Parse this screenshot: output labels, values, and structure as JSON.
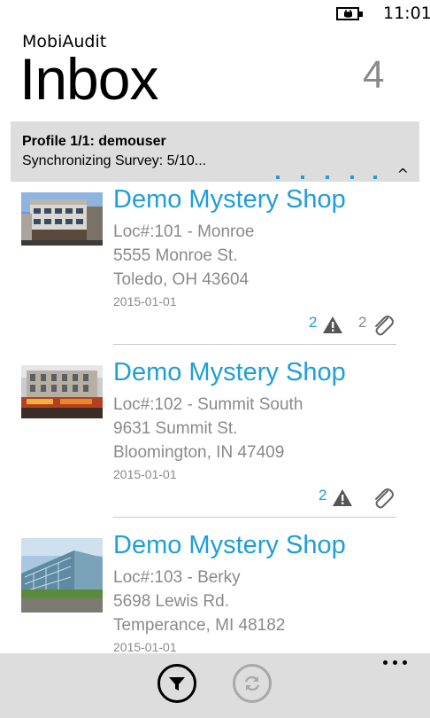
{
  "status_bar": {
    "time": "11:01",
    "battery_icon": "battery-charging-icon"
  },
  "header": {
    "app_name": "MobiAudit",
    "title": "Inbox",
    "count": "4"
  },
  "sync_banner": {
    "profile": "Profile 1/1: demouser",
    "status": "Synchronizing Survey: 5/10...",
    "caret": "^"
  },
  "items": [
    {
      "title": "Demo Mystery Shop",
      "location": "Loc#:101 - Monroe",
      "address": "5555 Monroe St.",
      "city": "Toledo, OH 43604",
      "date": "2015-01-01",
      "warnings": "2",
      "attachments": "2"
    },
    {
      "title": "Demo Mystery Shop",
      "location": "Loc#:102 - Summit South",
      "address": "9631 Summit St.",
      "city": "Bloomington, IN 47409",
      "date": "2015-01-01",
      "warnings": "2",
      "attachments": ""
    },
    {
      "title": "Demo Mystery Shop",
      "location": "Loc#:103 - Berky",
      "address": "5698 Lewis Rd.",
      "city": "Temperance, MI 48182",
      "date": "2015-01-01"
    }
  ],
  "app_bar": {
    "filter_icon": "filter-icon",
    "sync_icon": "sync-icon",
    "more_icon": "more-dots-icon"
  },
  "colors": {
    "accent": "#1f9ed8",
    "muted_text": "#8a8a8a",
    "banner_bg": "#dddddd",
    "app_bar_bg": "#dddddd"
  }
}
